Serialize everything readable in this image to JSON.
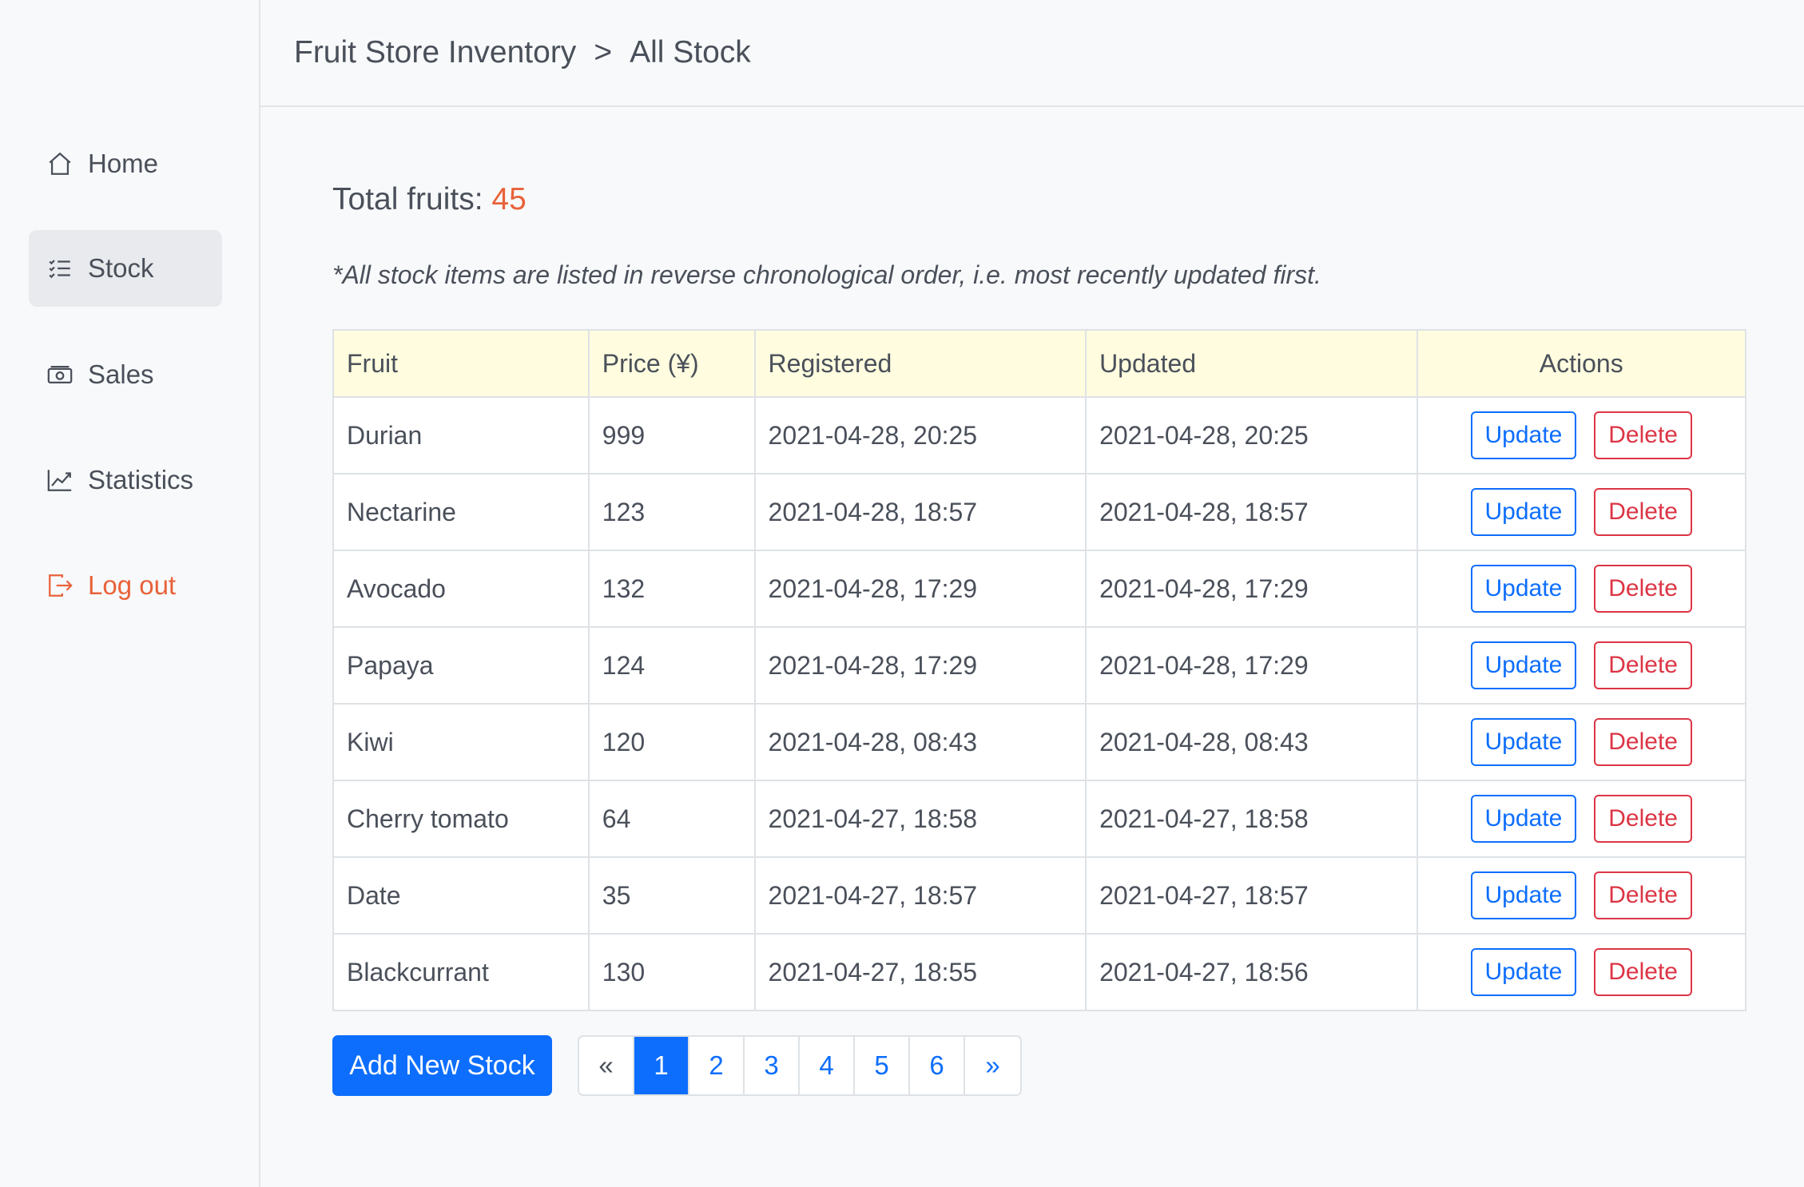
{
  "breadcrumb": {
    "root": "Fruit Store Inventory",
    "separator": ">",
    "current": "All Stock"
  },
  "sidebar": {
    "items": [
      {
        "label": "Home",
        "icon": "home-icon"
      },
      {
        "label": "Stock",
        "icon": "list-icon",
        "active": true
      },
      {
        "label": "Sales",
        "icon": "cash-icon"
      },
      {
        "label": "Statistics",
        "icon": "chart-icon"
      },
      {
        "label": "Log out",
        "icon": "logout-icon"
      }
    ]
  },
  "summary": {
    "label": "Total fruits:",
    "count": "45"
  },
  "note": "*All stock items are listed in reverse chronological order, i.e. most recently updated first.",
  "table": {
    "headers": [
      "Fruit",
      "Price (¥)",
      "Registered",
      "Updated",
      "Actions"
    ],
    "update_label": "Update",
    "delete_label": "Delete",
    "rows": [
      {
        "fruit": "Durian",
        "price": "999",
        "registered": "2021-04-28, 20:25",
        "updated": "2021-04-28, 20:25"
      },
      {
        "fruit": "Nectarine",
        "price": "123",
        "registered": "2021-04-28, 18:57",
        "updated": "2021-04-28, 18:57"
      },
      {
        "fruit": "Avocado",
        "price": "132",
        "registered": "2021-04-28, 17:29",
        "updated": "2021-04-28, 17:29"
      },
      {
        "fruit": "Papaya",
        "price": "124",
        "registered": "2021-04-28, 17:29",
        "updated": "2021-04-28, 17:29"
      },
      {
        "fruit": "Kiwi",
        "price": "120",
        "registered": "2021-04-28, 08:43",
        "updated": "2021-04-28, 08:43"
      },
      {
        "fruit": "Cherry tomato",
        "price": "64",
        "registered": "2021-04-27, 18:58",
        "updated": "2021-04-27, 18:58"
      },
      {
        "fruit": "Date",
        "price": "35",
        "registered": "2021-04-27, 18:57",
        "updated": "2021-04-27, 18:57"
      },
      {
        "fruit": "Blackcurrant",
        "price": "130",
        "registered": "2021-04-27, 18:55",
        "updated": "2021-04-27, 18:56"
      }
    ]
  },
  "add_button": "Add New Stock",
  "pagination": {
    "prev": "«",
    "pages": [
      "1",
      "2",
      "3",
      "4",
      "5",
      "6"
    ],
    "next": "»",
    "current": "1"
  },
  "colors": {
    "accent": "#0d6efd",
    "danger": "#dc3545",
    "highlight": "#e8623a",
    "header_bg": "#fffcdf"
  }
}
